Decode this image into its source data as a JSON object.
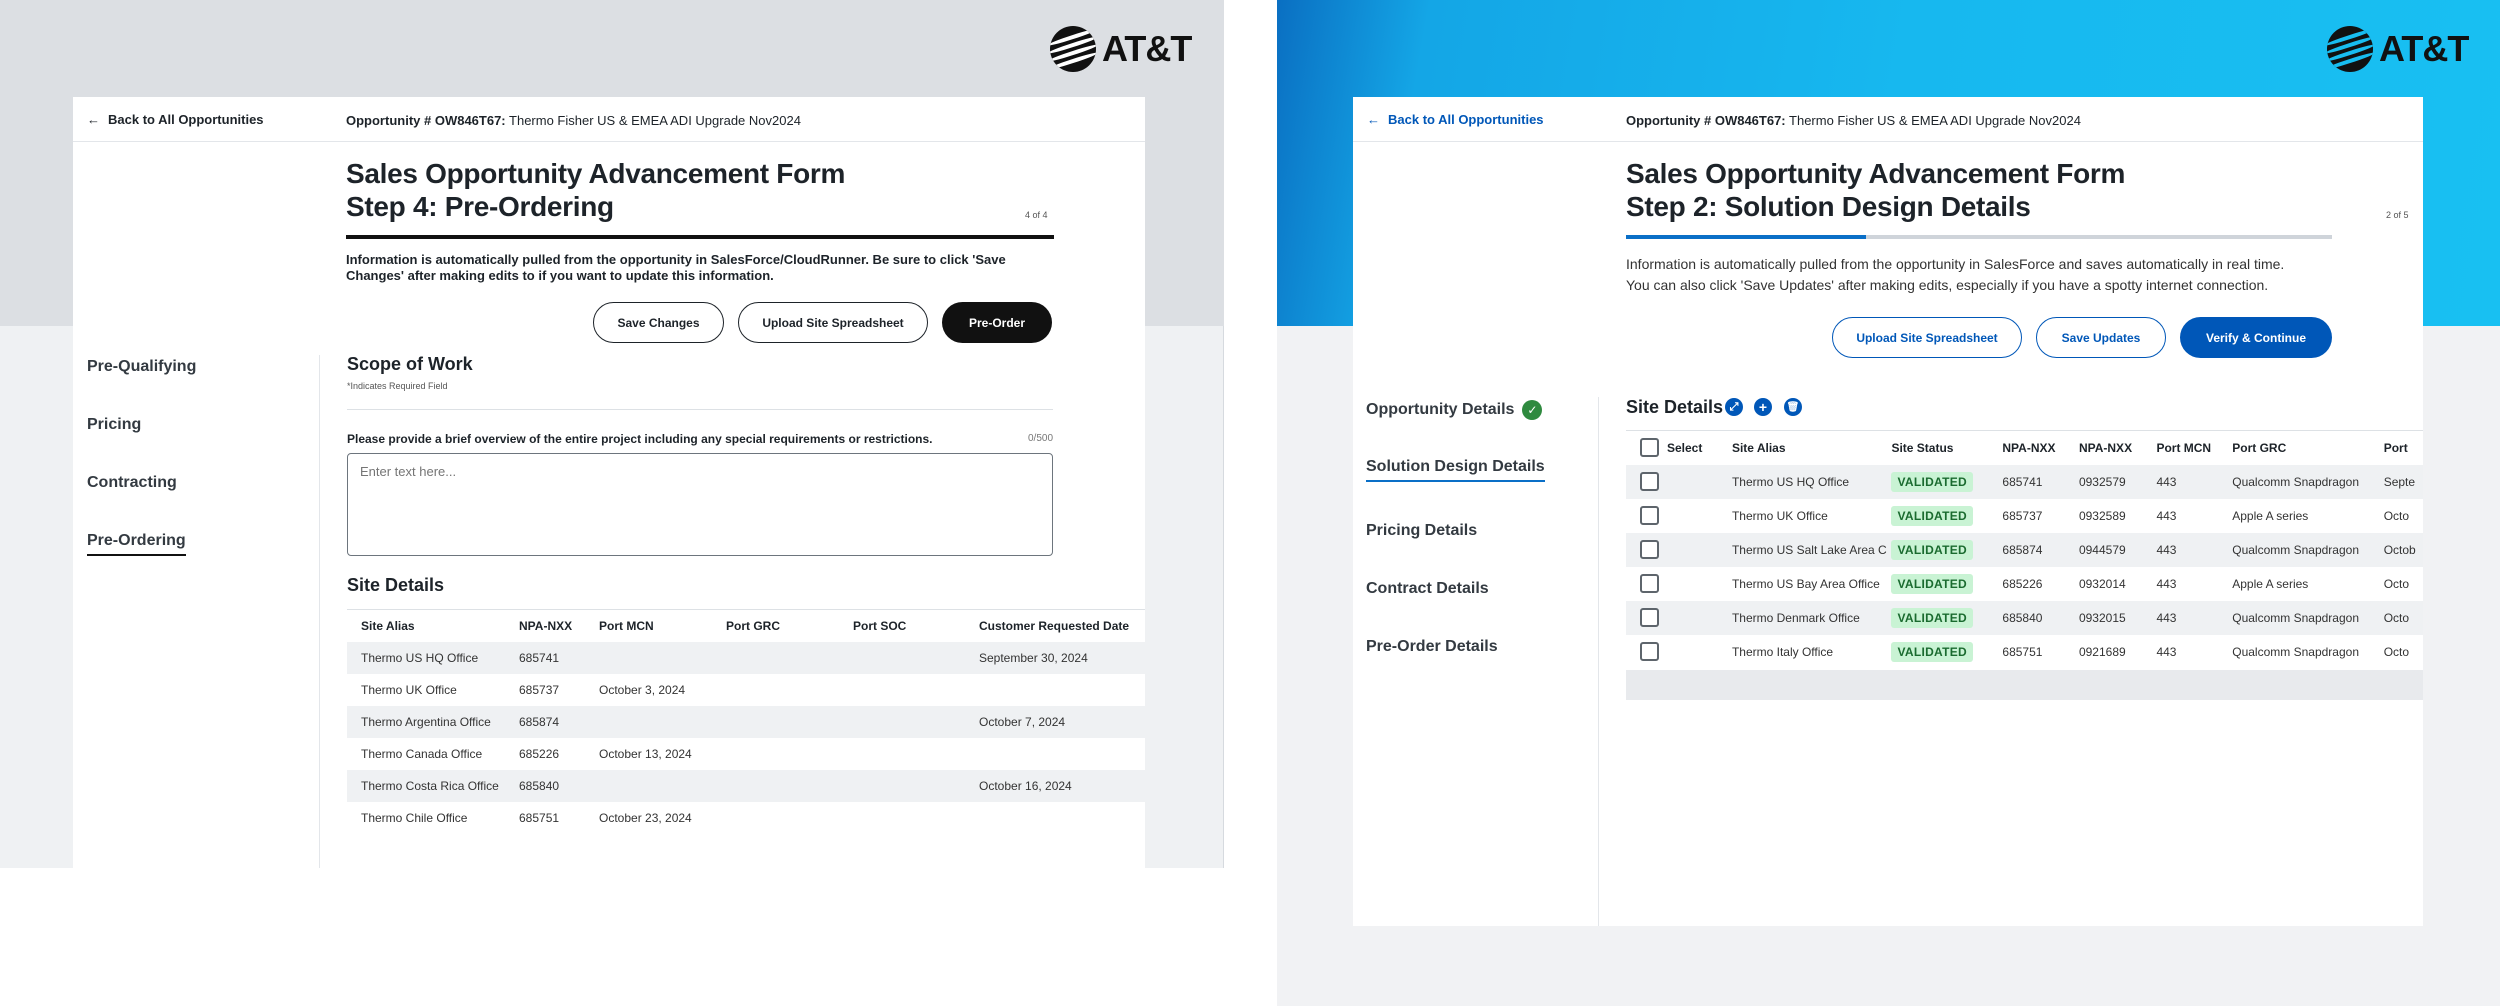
{
  "brand": {
    "name": "AT&T"
  },
  "colors": {
    "atnt_blue": "#0057b8",
    "dark": "#111111",
    "validated_bg": "#c9f3d4",
    "success_green": "#2f8a3f"
  },
  "left": {
    "back_link": "Back to All Opportunities",
    "opportunity_label": "Opportunity # OW846T67:",
    "opportunity_name": "Thermo Fisher US & EMEA ADI Upgrade Nov2024",
    "title_line1": "Sales Opportunity Advancement Form",
    "title_line2": "Step 4: Pre-Ordering",
    "step_count": "4 of 4",
    "progress_fraction": 1.0,
    "info_line1": "Information is automatically pulled from the opportunity in SalesForce/CloudRunner. Be sure to click 'Save",
    "info_line2": "Changes' after making edits to if you want to update this information.",
    "buttons": {
      "save": "Save Changes",
      "upload": "Upload Site Spreadsheet",
      "preorder": "Pre-Order"
    },
    "nav": [
      "Pre-Qualifying",
      "Pricing",
      "Contracting",
      "Pre-Ordering"
    ],
    "scope_title": "Scope of Work",
    "required_note": "*Indicates Required Field",
    "question": "Please provide a brief overview of the entire project including any special requirements or restrictions.",
    "char_count": "0/500",
    "textarea_placeholder": "Enter text here...",
    "site_details_title": "Site Details",
    "table": {
      "headers": [
        "Site Alias",
        "NPA-NXX",
        "Port MCN",
        "Port GRC",
        "Port SOC",
        "Customer Requested Date"
      ],
      "rows": [
        [
          "Thermo US HQ Office",
          "685741",
          "",
          "",
          "",
          "September 30, 2024"
        ],
        [
          "Thermo UK Office",
          "685737",
          "October 3, 2024",
          "",
          "",
          ""
        ],
        [
          "Thermo Argentina Office",
          "685874",
          "",
          "",
          "",
          "October 7, 2024"
        ],
        [
          "Thermo Canada Office",
          "685226",
          "October 13, 2024",
          "",
          "",
          ""
        ],
        [
          "Thermo Costa Rica Office",
          "685840",
          "",
          "",
          "",
          "October 16, 2024"
        ],
        [
          "Thermo Chile Office",
          "685751",
          "October 23, 2024",
          "",
          "",
          ""
        ]
      ]
    }
  },
  "right": {
    "back_link": "Back to All Opportunities",
    "opportunity_label": "Opportunity # OW846T67:",
    "opportunity_name": "Thermo Fisher US & EMEA ADI Upgrade Nov2024",
    "title_line1": "Sales Opportunity Advancement Form",
    "title_line2": "Step 2: Solution Design Details",
    "step_count": "2 of 5",
    "progress_fraction": 0.34,
    "info_line1": "Information is automatically pulled from the opportunity in SalesForce and saves automatically in real time.",
    "info_line2": "You can also click 'Save Updates'  after making edits, especially if you have a spotty internet connection.",
    "buttons": {
      "upload": "Upload Site Spreadsheet",
      "save": "Save Updates",
      "verify": "Verify & Continue"
    },
    "nav": [
      "Opportunity Details",
      "Solution Design Details",
      "Pricing Details",
      "Contract Details",
      "Pre-Order Details"
    ],
    "site_details_title": "Site Details",
    "table": {
      "headers": [
        "Select",
        "Site Alias",
        "Site Status",
        "NPA-NXX",
        "NPA-NXX",
        "Port MCN",
        "Port GRC",
        "Port"
      ],
      "rows": [
        [
          "Thermo US HQ Office",
          "VALIDATED",
          "685741",
          "0932579",
          "443",
          "Qualcomm Snapdragon",
          "Septe"
        ],
        [
          "Thermo UK Office",
          "VALIDATED",
          "685737",
          "0932589",
          "443",
          "Apple A series",
          "Octo"
        ],
        [
          "Thermo US Salt Lake Area C",
          "VALIDATED",
          "685874",
          "0944579",
          "443",
          "Qualcomm Snapdragon",
          "Octob"
        ],
        [
          "Thermo US Bay Area Office",
          "VALIDATED",
          "685226",
          "0932014",
          "443",
          "Apple A series",
          "Octo"
        ],
        [
          "Thermo Denmark Office",
          "VALIDATED",
          "685840",
          "0932015",
          "443",
          "Qualcomm Snapdragon",
          "Octo"
        ],
        [
          "Thermo Italy Office",
          "VALIDATED",
          "685751",
          "0921689",
          "443",
          "Qualcomm Snapdragon",
          "Octo"
        ]
      ]
    }
  }
}
